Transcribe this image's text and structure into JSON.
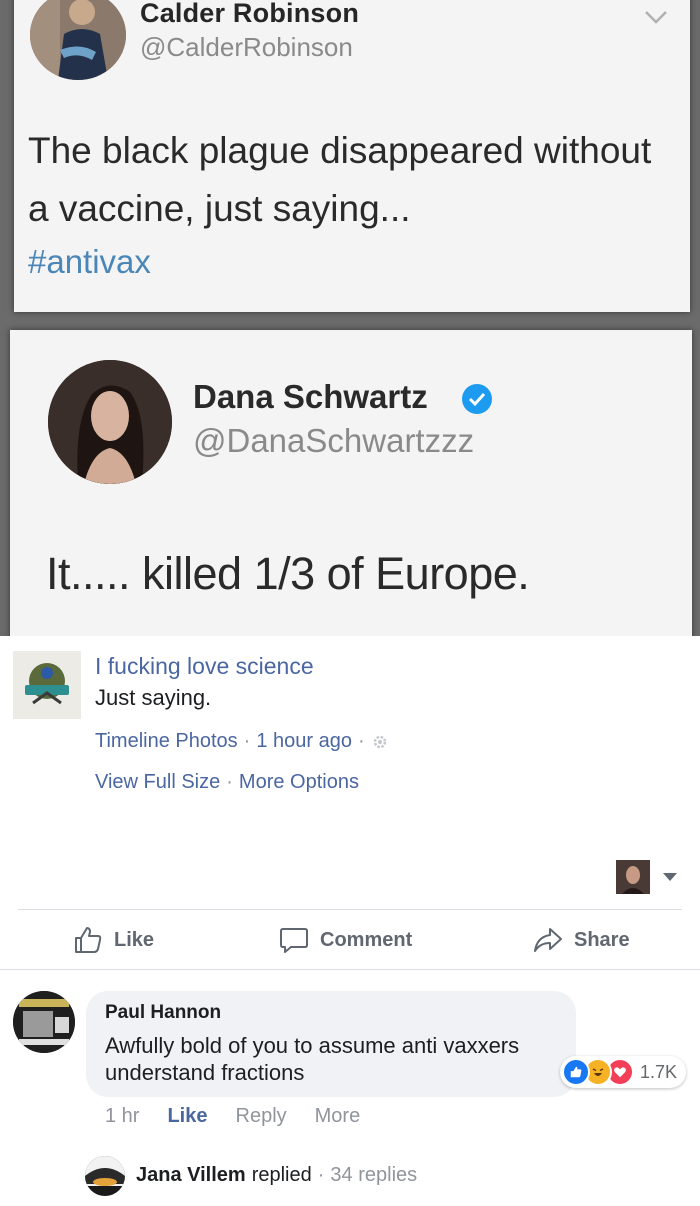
{
  "tweet1": {
    "name": "Calder Robinson",
    "handle": "@CalderRobinson",
    "text": "The black plague disappeared without a vaccine, just saying...",
    "hashtag": "#antivax"
  },
  "tweet2": {
    "name": "Dana Schwartz",
    "handle": "@DanaSchwartzzz",
    "text": "It..... killed 1/3 of Europe."
  },
  "post": {
    "page_name": "I fucking love science",
    "caption": "Just saying.",
    "meta": {
      "album": "Timeline Photos",
      "time": "1 hour ago",
      "view_full_size": "View Full Size",
      "more_options": "More Options"
    },
    "actions": {
      "like": "Like",
      "comment": "Comment",
      "share": "Share"
    }
  },
  "comment": {
    "author": "Paul Hannon",
    "text": "Awfully bold of you to assume anti vaxxers understand fractions",
    "reaction_count": "1.7K",
    "reactions": [
      "like",
      "haha",
      "love"
    ],
    "time": "1 hr",
    "like_label": "Like",
    "reply_label": "Reply",
    "more_label": "More"
  },
  "reply_summary": {
    "name": "Jana Villem",
    "verb": "replied",
    "count": "34 replies"
  },
  "colors": {
    "facebook_link": "#4b67a1",
    "hashtag": "#4a87b8",
    "verified": "#1d9bf0"
  }
}
